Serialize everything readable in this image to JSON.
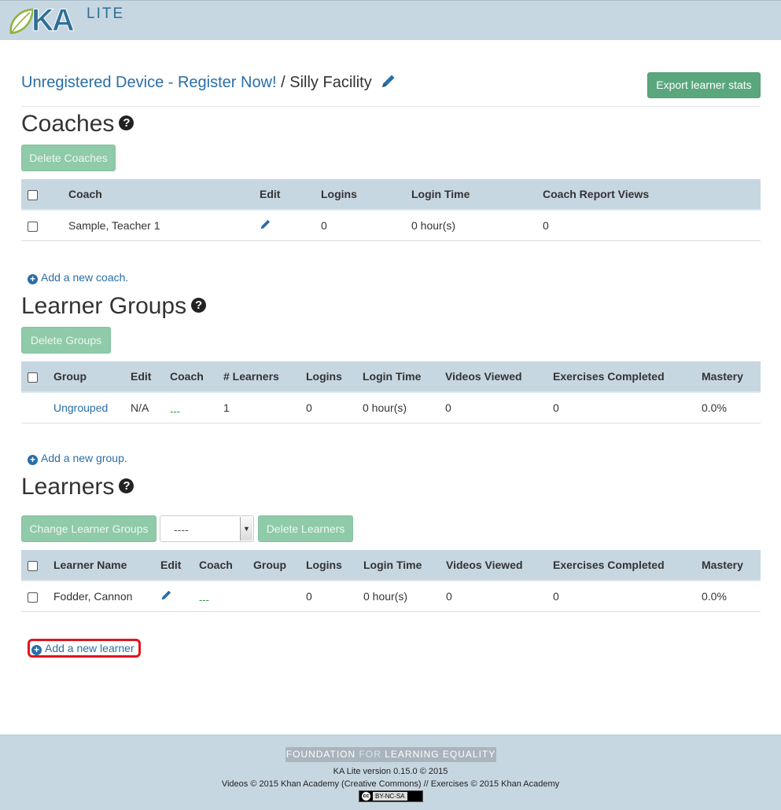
{
  "brand": {
    "logo_main": "KA",
    "logo_sub": "LITE",
    "accent": "#2d6f96",
    "header_bg": "#c7d7e2"
  },
  "breadcrumb": {
    "device_link": "Unregistered Device - Register Now!",
    "separator": "/",
    "facility": "Silly Facility",
    "edit_icon": "pencil-icon"
  },
  "export_button": "Export learner stats",
  "coaches": {
    "title": "Coaches",
    "delete_button": "Delete Coaches",
    "columns": [
      "Coach",
      "Edit",
      "Logins",
      "Login Time",
      "Coach Report Views"
    ],
    "rows": [
      {
        "name": "Sample, Teacher 1",
        "logins": "0",
        "login_time": "0 hour(s)",
        "report_views": "0"
      }
    ],
    "add_link": "Add a new coach."
  },
  "groups": {
    "title": "Learner Groups",
    "delete_button": "Delete Groups",
    "columns": [
      "Group",
      "Edit",
      "Coach",
      "# Learners",
      "Logins",
      "Login Time",
      "Videos Viewed",
      "Exercises Completed",
      "Mastery"
    ],
    "rows": [
      {
        "group": "Ungrouped",
        "edit": "N/A",
        "coach": "---",
        "learners": "1",
        "logins": "0",
        "login_time": "0 hour(s)",
        "videos": "0",
        "exercises": "0",
        "mastery": "0.0%"
      }
    ],
    "add_link": "Add a new group."
  },
  "learners": {
    "title": "Learners",
    "change_button": "Change Learner Groups",
    "group_select": "----",
    "delete_button": "Delete Learners",
    "columns": [
      "Learner Name",
      "Edit",
      "Coach",
      "Group",
      "Logins",
      "Login Time",
      "Videos Viewed",
      "Exercises Completed",
      "Mastery"
    ],
    "rows": [
      {
        "name": "Fodder, Cannon",
        "coach": "---",
        "group": "",
        "logins": "0",
        "login_time": "0 hour(s)",
        "videos": "0",
        "exercises": "0",
        "mastery": "0.0%"
      }
    ],
    "add_link": "Add a new learner"
  },
  "footer": {
    "fle_a": "FOUNDATION",
    "fle_b": "FOR",
    "fle_c": "LEARNING EQUALITY",
    "version": "KA Lite version 0.15.0 © 2015",
    "credits": "Videos © 2015 Khan Academy (Creative Commons) // Exercises © 2015 Khan Academy",
    "license_badge_c": "cc",
    "license_badge_text": "BY-NC-SA"
  }
}
